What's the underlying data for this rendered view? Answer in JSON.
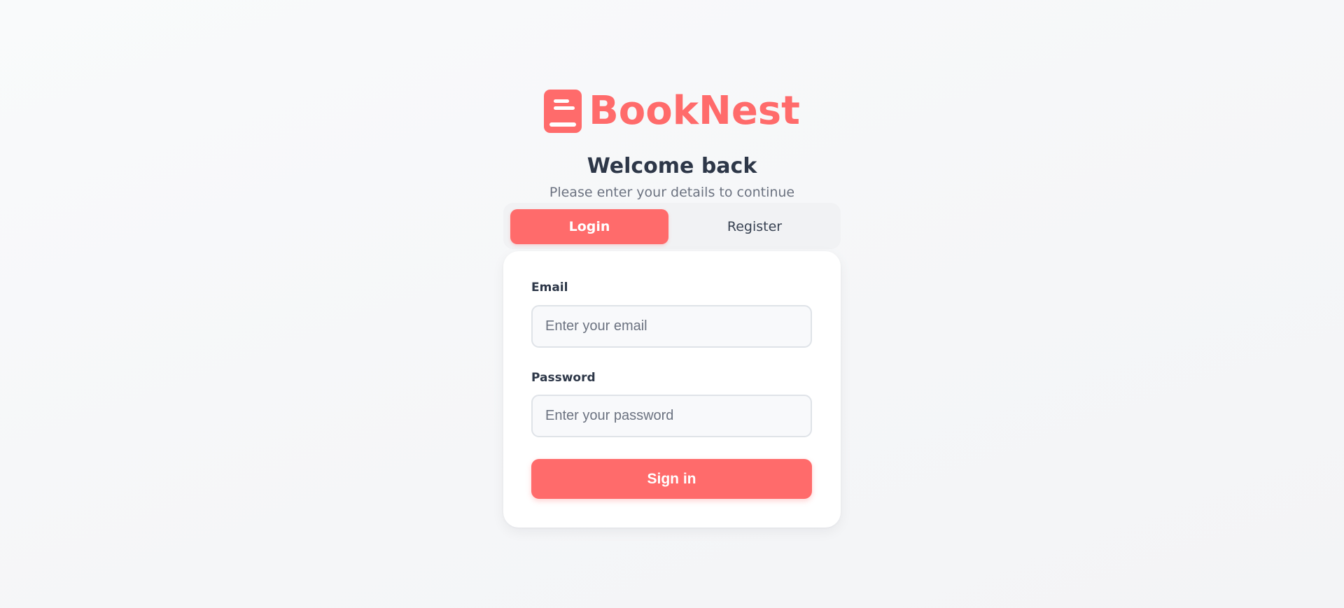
{
  "brand": {
    "name": "BookNest",
    "icon": "book-icon",
    "color": "#ff6b6b"
  },
  "heading": {
    "title": "Welcome back",
    "subtitle": "Please enter your details to continue"
  },
  "tabs": [
    {
      "label": "Login",
      "active": true
    },
    {
      "label": "Register",
      "active": false
    }
  ],
  "form": {
    "email": {
      "label": "Email",
      "value": "",
      "placeholder": "Enter your email"
    },
    "password": {
      "label": "Password",
      "value": "",
      "placeholder": "Enter your password"
    },
    "submit_label": "Sign in"
  },
  "colors": {
    "accent": "#ff6b6b",
    "text_dark": "#2d3748",
    "text_muted": "#6b7280"
  }
}
